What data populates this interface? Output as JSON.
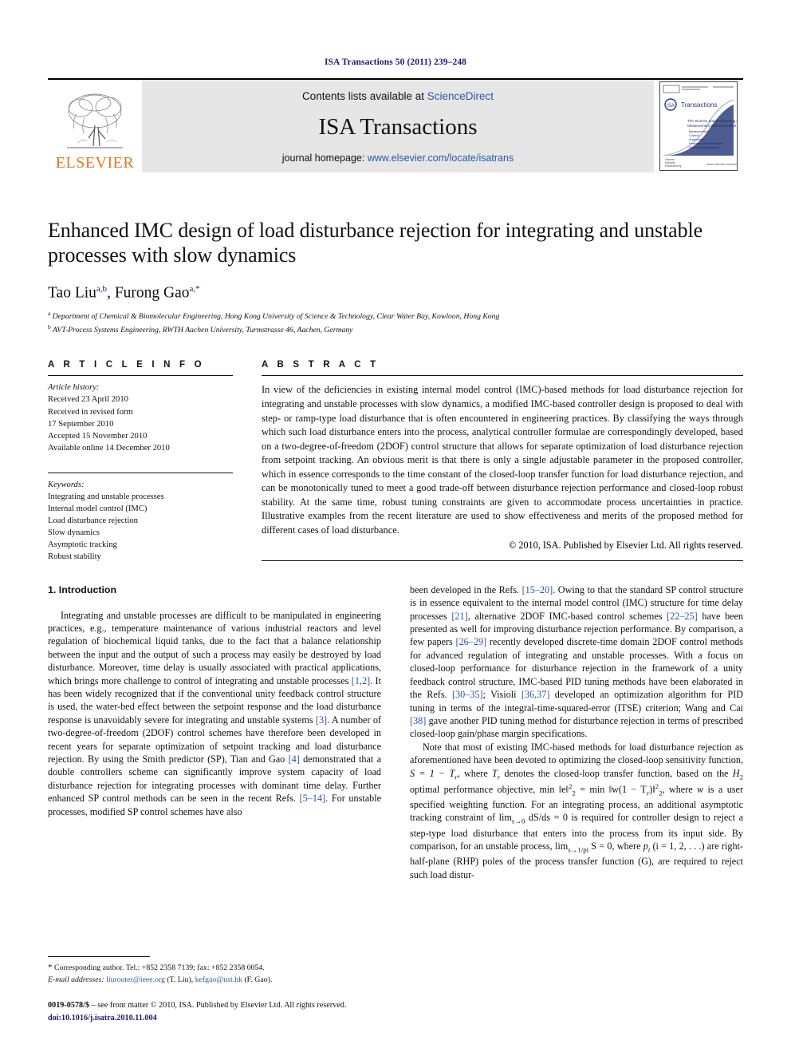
{
  "running_head": "ISA Transactions 50 (2011) 239–248",
  "banner": {
    "publisher_name": "ELSEVIER",
    "contents_prefix": "Contents lists available at ",
    "contents_link": "ScienceDirect",
    "journal_title": "ISA Transactions",
    "homepage_prefix": "journal homepage: ",
    "homepage_url": "www.elsevier.com/locate/isatrans",
    "cover_title": "Transactions",
    "cover_logo_text": "ISA",
    "cover_subtitle": "The Science and Engineering of Measurement and Automation"
  },
  "article": {
    "title": "Enhanced IMC design of load disturbance rejection for integrating and unstable processes with slow dynamics",
    "authors": "Tao Liu",
    "author1_sup": "a,b",
    "authors2": ", Furong Gao",
    "author2_sup": "a,*",
    "affiliation_a_sup": "a",
    "affiliation_a": "Department of Chemical & Biomolecular Engineering, Hong Kong University of Science & Technology, Clear Water Bay, Kowloon, Hong Kong",
    "affiliation_b_sup": "b",
    "affiliation_b": "AVT-Process Systems Engineering, RWTH Aachen University, Turmstrasse 46, Aachen, Germany"
  },
  "info": {
    "label": "A R T I C L E    I N F O",
    "history_label": "Article history:",
    "history": [
      "Received 23 April 2010",
      "Received in revised form",
      "17 September 2010",
      "Accepted 15 November 2010",
      "Available online 14 December 2010"
    ],
    "keywords_label": "Keywords:",
    "keywords": [
      "Integrating and unstable processes",
      "Internal model control (IMC)",
      "Load disturbance rejection",
      "Slow dynamics",
      "Asymptotic tracking",
      "Robust stability"
    ]
  },
  "abstract": {
    "label": "A B S T R A C T",
    "text": "In view of the deficiencies in existing internal model control (IMC)-based methods for load disturbance rejection for integrating and unstable processes with slow dynamics, a modified IMC-based controller design is proposed to deal with step- or ramp-type load disturbance that is often encountered in engineering practices. By classifying the ways through which such load disturbance enters into the process, analytical controller formulae are correspondingly developed, based on a two-degree-of-freedom (2DOF) control structure that allows for separate optimization of load disturbance rejection from setpoint tracking. An obvious merit is that there is only a single adjustable parameter in the proposed controller, which in essence corresponds to the time constant of the closed-loop transfer function for load disturbance rejection, and can be monotonically tuned to meet a good trade-off between disturbance rejection performance and closed-loop robust stability. At the same time, robust tuning constraints are given to accommodate process uncertainties in practice. Illustrative examples from the recent literature are used to show effectiveness and merits of the proposed method for different cases of load disturbance.",
    "copyright": "© 2010, ISA. Published by Elsevier Ltd. All rights reserved."
  },
  "body": {
    "section_number_title": "1. Introduction",
    "left_paragraph_1_a": "Integrating and unstable processes are difficult to be manipulated in engineering practices, e.g., temperature maintenance of various industrial reactors and level regulation of biochemical liquid tanks, due to the fact that a balance relationship between the input and the output of such a process may easily be destroyed by load disturbance. Moreover, time delay is usually associated with practical applications, which brings more challenge to control of integrating and unstable processes ",
    "ref_1_2": "[1,2]",
    "left_paragraph_1_b": ". It has been widely recognized that if the conventional unity feedback control structure is used, the water-bed effect between the setpoint response and the load disturbance response is unavoidably severe for integrating and unstable systems ",
    "ref_3": "[3]",
    "left_paragraph_1_c": ". A number of two-degree-of-freedom (2DOF) control schemes have therefore been developed in recent years for separate optimization of setpoint tracking and load disturbance rejection. By using the Smith predictor (SP), Tian and Gao ",
    "ref_4": "[4]",
    "left_paragraph_1_d": " demonstrated that a double controllers scheme can significantly improve system capacity of load disturbance rejection for integrating processes with dominant time delay. Further enhanced SP control methods can be seen in the recent Refs. ",
    "ref_5_14": "[5–14]",
    "left_paragraph_1_e": ". For unstable processes, modified SP control schemes have also",
    "right_paragraph_1_a": "been developed in the Refs. ",
    "ref_15_20": "[15–20]",
    "right_paragraph_1_b": ". Owing to that the standard SP control structure is in essence equivalent to the internal model control (IMC) structure for time delay processes ",
    "ref_21": "[21]",
    "right_paragraph_1_c": ", alternative 2DOF IMC-based control schemes ",
    "ref_22_25": "[22–25]",
    "right_paragraph_1_d": " have been presented as well for improving disturbance rejection performance. By comparison, a few papers ",
    "ref_26_29": "[26–29]",
    "right_paragraph_1_e": " recently developed discrete-time domain 2DOF control methods for advanced regulation of integrating and unstable processes. With a focus on closed-loop performance for disturbance rejection in the framework of a unity feedback control structure, IMC-based PID tuning methods have been elaborated in the Refs. ",
    "ref_30_35": "[30–35]",
    "right_paragraph_1_f": "; Visioli ",
    "ref_36_37": "[36,37]",
    "right_paragraph_1_g": " developed an optimization algorithm for PID tuning in terms of the integral-time-squared-error (ITSE) criterion; Wang and Cai ",
    "ref_38": "[38]",
    "right_paragraph_1_h": " gave another PID tuning method for disturbance rejection in terms of prescribed closed-loop gain/phase margin specifications.",
    "right_paragraph_2_a": "Note that most of existing IMC-based methods for load disturbance rejection as aforementioned have been devoted to optimizing the closed-loop sensitivity function, ",
    "math_S": "S = 1 − T",
    "math_S_sub": "r",
    "right_paragraph_2_b": ", where ",
    "math_Tr": "T",
    "math_Tr_sub": "r",
    "right_paragraph_2_c": " denotes the closed-loop transfer function, based on the ",
    "math_H2": "H",
    "math_H2_sub": "2",
    "right_paragraph_2_d": " optimal performance objective, min ‖e‖",
    "math_norm_sup": "2",
    "math_norm_sub": "2",
    "right_paragraph_2_e": " = min ‖w(1 − T",
    "math_Tr2_sub": "r",
    "right_paragraph_2_f": ")‖",
    "right_paragraph_2_g": ", where ",
    "math_w": "w",
    "right_paragraph_2_h": " is a user specified weighting function. For an integrating process, an additional asymptotic tracking constraint of lim",
    "math_lim1_sub": "s→0",
    "right_paragraph_2_i": " dS/ds = 0 is required for controller design to reject a step-type load disturbance that enters into the process from its input side. By comparison, for an unstable process, lim",
    "math_lim2_sub": "s→1/p",
    "math_lim2_sub2": "i",
    "right_paragraph_2_j": " S = 0, where ",
    "math_pi": "p",
    "math_pi_sub": "i",
    "right_paragraph_2_k": " (i = 1, 2, . . .) are right-half-plane (RHP) poles of the process transfer function (G), are required to reject such load distur-"
  },
  "footnote": {
    "star": "*",
    "corresponding": "Corresponding author. Tel.: +852 2358 7139; fax: +852 2358 0054.",
    "email_label": "E-mail addresses:",
    "email1": "liurouter@ieee.org",
    "email1_owner": "(T. Liu),",
    "email2": "kefgao@ust.hk",
    "email2_owner": "(F. Gao)."
  },
  "page_footer": {
    "issn": "0019-0578/$",
    "front_matter": " – see front matter © 2010, ISA. Published by Elsevier Ltd. All rights reserved.",
    "doi": "doi:10.1016/j.isatra.2010.11.004"
  }
}
